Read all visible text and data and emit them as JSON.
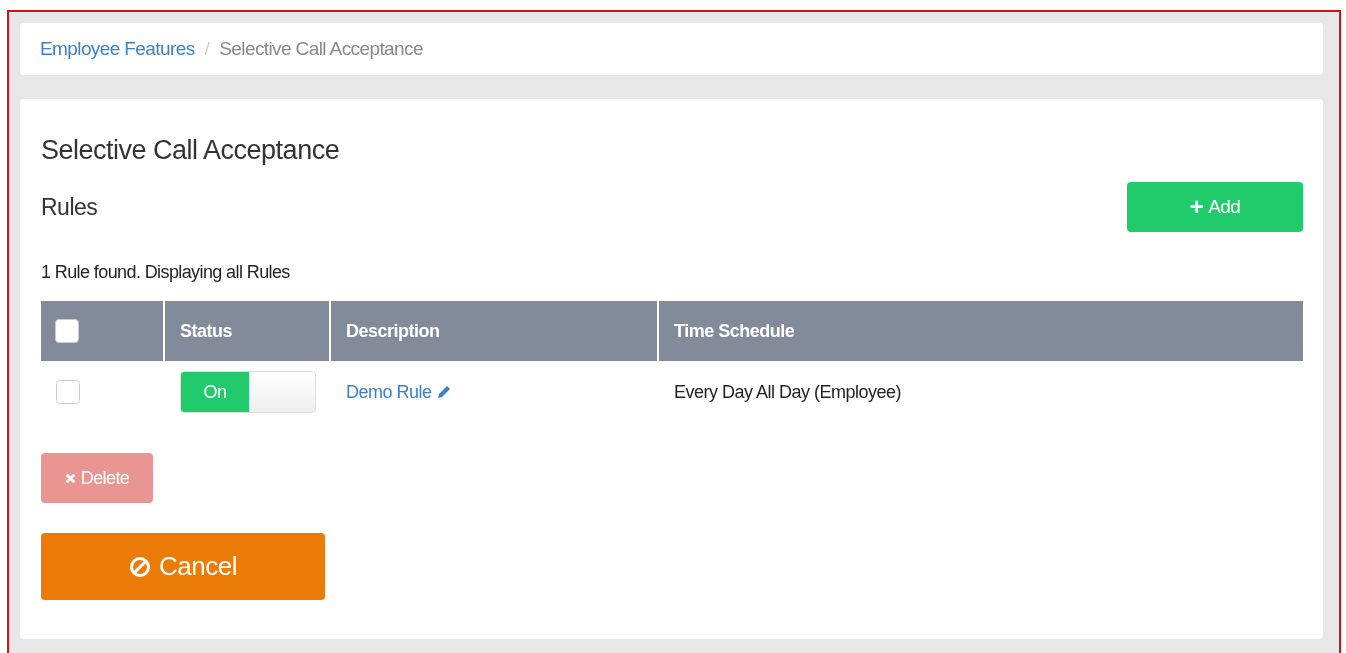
{
  "breadcrumb": [
    {
      "label": "Employee Features",
      "kind": "link"
    },
    {
      "label": "/",
      "kind": "separator"
    },
    {
      "label": "Selective Call Acceptance",
      "kind": "current"
    }
  ],
  "page_title": "Selective Call Acceptance",
  "section_title": "Rules",
  "add_button": {
    "icon": "+",
    "label": "Add"
  },
  "summary": "1 Rule found. Displaying all Rules",
  "table": {
    "header_checkbox": {
      "checked": false
    },
    "columns": [
      "Status",
      "Description",
      "Time Schedule"
    ],
    "rows": [
      {
        "checked": false,
        "status": {
          "on": true,
          "label": "On"
        },
        "description": "Demo Rule",
        "time_schedule": "Every Day All Day (Employee)"
      }
    ]
  },
  "delete_button": {
    "label": "Delete",
    "disabled": true
  },
  "cancel_button": {
    "label": "Cancel"
  }
}
